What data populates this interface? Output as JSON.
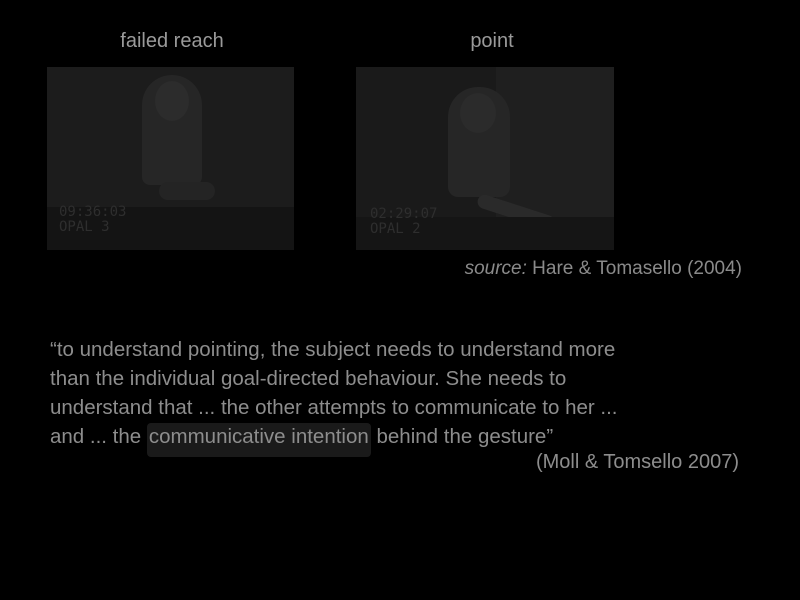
{
  "slide": {
    "captions": {
      "left": "failed reach",
      "right": "point"
    },
    "images": {
      "left": {
        "stamp_line1": "09:36:03",
        "stamp_line2": "OPAL 3"
      },
      "right": {
        "stamp_line1": "02:29:07",
        "stamp_line2": "OPAL 2"
      }
    },
    "source": {
      "prefix": "source:",
      "text": " Hare & Tomasello (2004)"
    },
    "quote": {
      "line1": "“to understand pointing, the subject needs to understand more",
      "line2": "than the individual goal-directed behaviour. She needs to",
      "line3": "understand that ... the other attempts to communicate to her ...",
      "line4_before": "and ... the ",
      "line4_highlight": "communicative intention",
      "line4_after": " behind the gesture”",
      "attribution": "(Moll & Tomsello 2007)"
    },
    "colors": {
      "background": "#000000",
      "text": "#8d8d8d",
      "highlight": "#1a1a1a"
    }
  }
}
